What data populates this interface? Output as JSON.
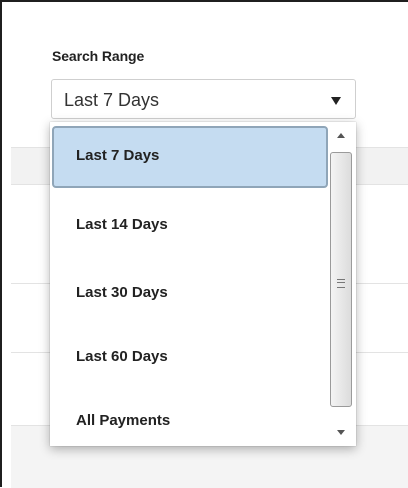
{
  "search_range": {
    "label": "Search Range",
    "selected_value": "Last 7 Days",
    "options": [
      {
        "label": "Last 7 Days",
        "selected": true
      },
      {
        "label": "Last 14 Days",
        "selected": false
      },
      {
        "label": "Last 30 Days",
        "selected": false
      },
      {
        "label": "Last 60 Days",
        "selected": false
      },
      {
        "label": "All Payments",
        "selected": false
      }
    ]
  },
  "icons": {
    "dropdown_arrow": "caret-down-icon",
    "scroll_up": "scroll-up-arrow-icon",
    "scroll_down": "scroll-down-arrow-icon",
    "scroll_grip": "grip-icon"
  },
  "colors": {
    "selected_option_bg": "#c5dcf1",
    "selected_option_border": "#8fa5b8",
    "text": "#222222"
  }
}
